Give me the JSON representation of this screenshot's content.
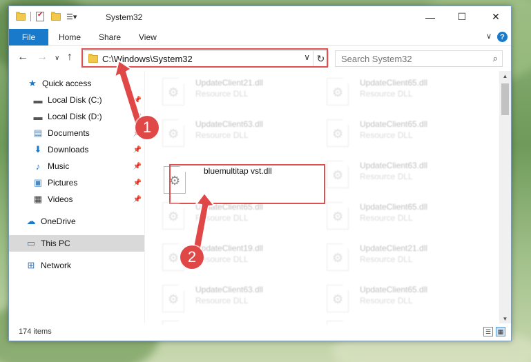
{
  "window": {
    "title": "System32",
    "controls": {
      "minimize": "—",
      "maximize": "☐",
      "close": "✕"
    }
  },
  "ribbon": {
    "file_tab": "File",
    "tabs": [
      "Home",
      "Share",
      "View"
    ],
    "help": "?"
  },
  "navigation": {
    "address": "C:\\Windows\\System32",
    "search_placeholder": "Search System32"
  },
  "sidebar": {
    "items": [
      {
        "label": "Quick access",
        "icon": "star-icon",
        "pinned": false
      },
      {
        "label": "Local Disk (C:)",
        "icon": "drive-icon",
        "pinned": true
      },
      {
        "label": "Local Disk (D:)",
        "icon": "drive-icon",
        "pinned": true
      },
      {
        "label": "Documents",
        "icon": "documents-icon",
        "pinned": true
      },
      {
        "label": "Downloads",
        "icon": "download-icon",
        "pinned": true
      },
      {
        "label": "Music",
        "icon": "music-icon",
        "pinned": true
      },
      {
        "label": "Pictures",
        "icon": "pictures-icon",
        "pinned": true
      },
      {
        "label": "Videos",
        "icon": "videos-icon",
        "pinned": true
      },
      {
        "label": "OneDrive",
        "icon": "cloud-icon",
        "pinned": false
      },
      {
        "label": "This PC",
        "icon": "computer-icon",
        "pinned": false,
        "selected": true
      },
      {
        "label": "Network",
        "icon": "network-icon",
        "pinned": false
      }
    ]
  },
  "files": [
    {
      "name": "UpdateClient21.dll",
      "type": "Resource DLL",
      "highlighted": false
    },
    {
      "name": "UpdateClient65.dll",
      "type": "Resource DLL",
      "highlighted": false
    },
    {
      "name": "UpdateClient63.dll",
      "type": "Resource DLL",
      "highlighted": false
    },
    {
      "name": "UpdateClient65.dll",
      "type": "Resource DLL",
      "highlighted": false
    },
    {
      "name": "bluemultitap vst.dll",
      "type": "",
      "highlighted": true
    },
    {
      "name": "UpdateClient63.dll",
      "type": "Resource DLL",
      "highlighted": false
    },
    {
      "name": "UpdateClient65.dll",
      "type": "Resource DLL",
      "highlighted": false
    },
    {
      "name": "UpdateClient65.dll",
      "type": "Resource DLL",
      "highlighted": false
    },
    {
      "name": "UpdateClient19.dll",
      "type": "Resource DLL",
      "highlighted": false
    },
    {
      "name": "UpdateClient21.dll",
      "type": "Resource DLL",
      "highlighted": false
    },
    {
      "name": "UpdateClient63.dll",
      "type": "Resource DLL",
      "highlighted": false
    },
    {
      "name": "UpdateClient65.dll",
      "type": "Resource DLL",
      "highlighted": false
    },
    {
      "name": "",
      "type": "",
      "highlighted": false
    },
    {
      "name": "",
      "type": "",
      "highlighted": false
    }
  ],
  "status": {
    "item_count": "174 items"
  },
  "annotations": {
    "step1": "1",
    "step2": "2",
    "color": "#e04848"
  },
  "colors": {
    "accent": "#1979ca",
    "selection": "#d9d9d9"
  }
}
